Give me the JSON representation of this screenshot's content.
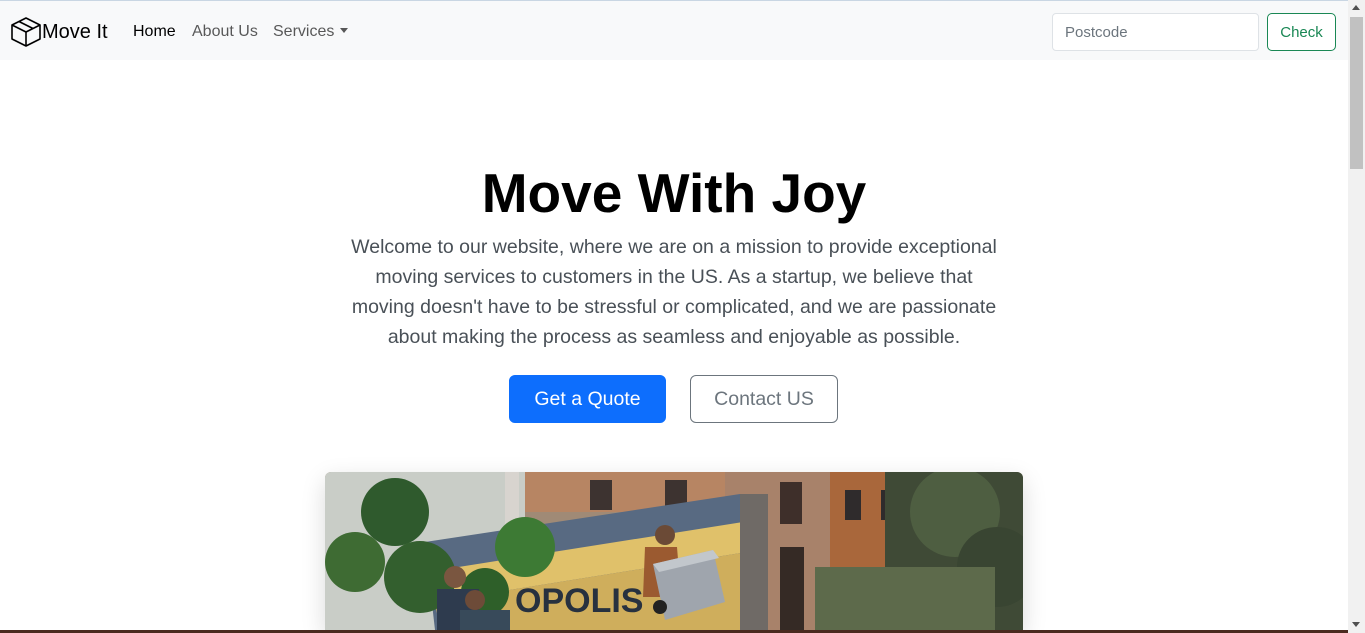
{
  "navbar": {
    "brand": "Move It",
    "links": [
      {
        "label": "Home",
        "active": true
      },
      {
        "label": "About Us",
        "active": false
      },
      {
        "label": "Services",
        "active": false
      }
    ],
    "search": {
      "placeholder": "Postcode",
      "value": ""
    },
    "check_label": "Check"
  },
  "hero": {
    "title": "Move With Joy",
    "text": "Welcome to our website, where we are on a mission to provide exceptional moving services to customers in the US. As a startup, we believe that moving doesn't have to be stressful or complicated, and we are passionate about making the process as seamless and enjoyable as possible.",
    "primary_button": "Get a Quote",
    "secondary_button": "Contact US",
    "image_truck_text": "OPOLIS"
  },
  "colors": {
    "primary": "#0d6efd",
    "success": "#198754",
    "navbar_bg": "#f8f9fa",
    "muted": "#6c757d"
  },
  "icons": {
    "brand": "box-icon",
    "services_dropdown": "caret-down-icon"
  }
}
